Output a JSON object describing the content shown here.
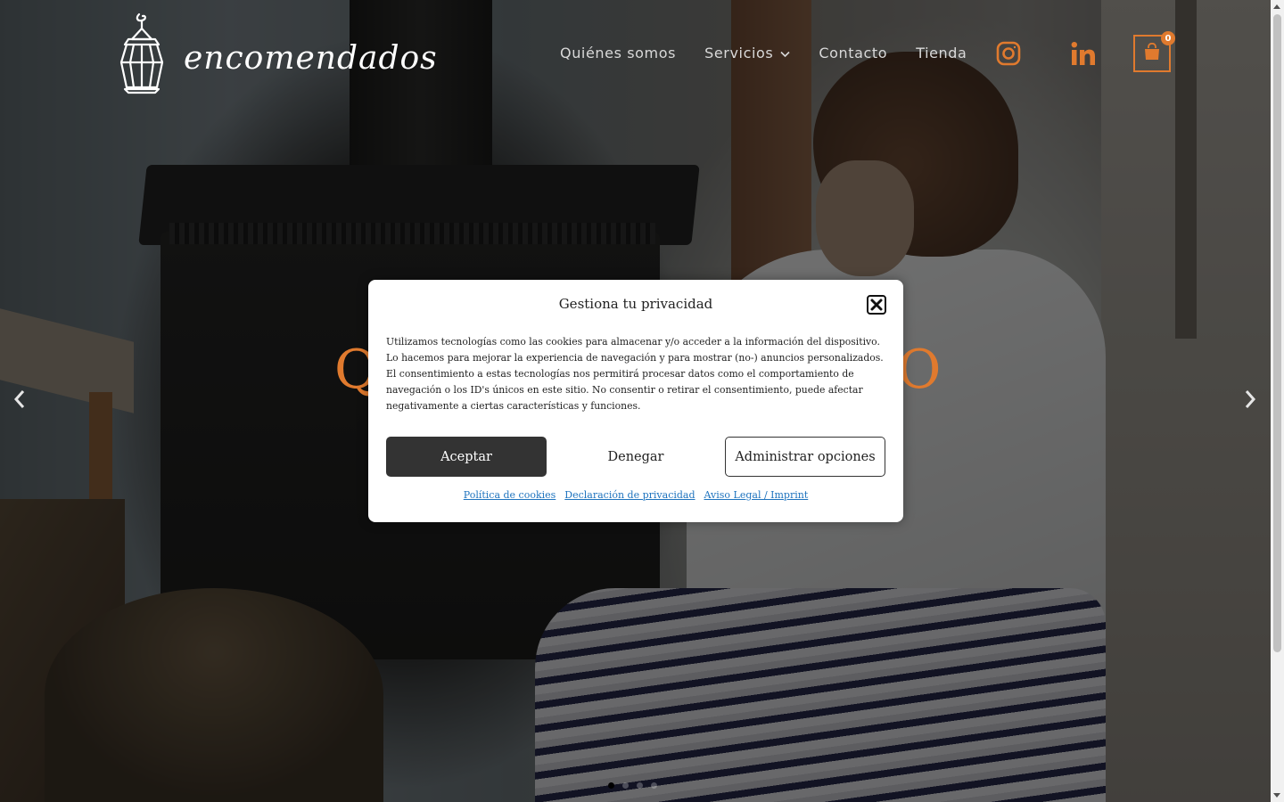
{
  "brand": {
    "logo_text": "encomendados",
    "logo_icon": "lantern-icon"
  },
  "nav": {
    "items": [
      {
        "label": "Quiénes somos"
      },
      {
        "label": "Servicios",
        "has_dropdown": true
      },
      {
        "label": "Contacto"
      },
      {
        "label": "Tienda"
      }
    ]
  },
  "social": {
    "instagram_icon": "instagram-icon",
    "linkedin_icon": "linkedin-icon"
  },
  "cart": {
    "icon": "shopping-bag-icon",
    "count": "0"
  },
  "hero": {
    "heading_visible_left": "Q",
    "heading_visible_right": "O"
  },
  "slider": {
    "prev_icon": "chevron-left-icon",
    "next_icon": "chevron-right-icon",
    "slide_count": 4,
    "active_index": 0
  },
  "cookie_modal": {
    "title": "Gestiona tu privacidad",
    "body": "Utilizamos tecnologías como las cookies para almacenar y/o acceder a la información del dispositivo. Lo hacemos para mejorar la experiencia de navegación y para mostrar (no-) anuncios personalizados. El consentimiento a estas tecnologías nos permitirá procesar datos como el comportamiento de navegación o los ID's únicos en este sitio. No consentir o retirar el consentimiento, puede afectar negativamente a ciertas características y funciones.",
    "accept_label": "Aceptar",
    "deny_label": "Denegar",
    "manage_label": "Administrar opciones",
    "links": [
      {
        "label": "Política de cookies"
      },
      {
        "label": "Declaración de privacidad"
      },
      {
        "label": "Aviso Legal / Imprint"
      }
    ]
  },
  "colors": {
    "accent": "#e07a2e",
    "button_dark": "#333333",
    "link": "#1e73be"
  }
}
